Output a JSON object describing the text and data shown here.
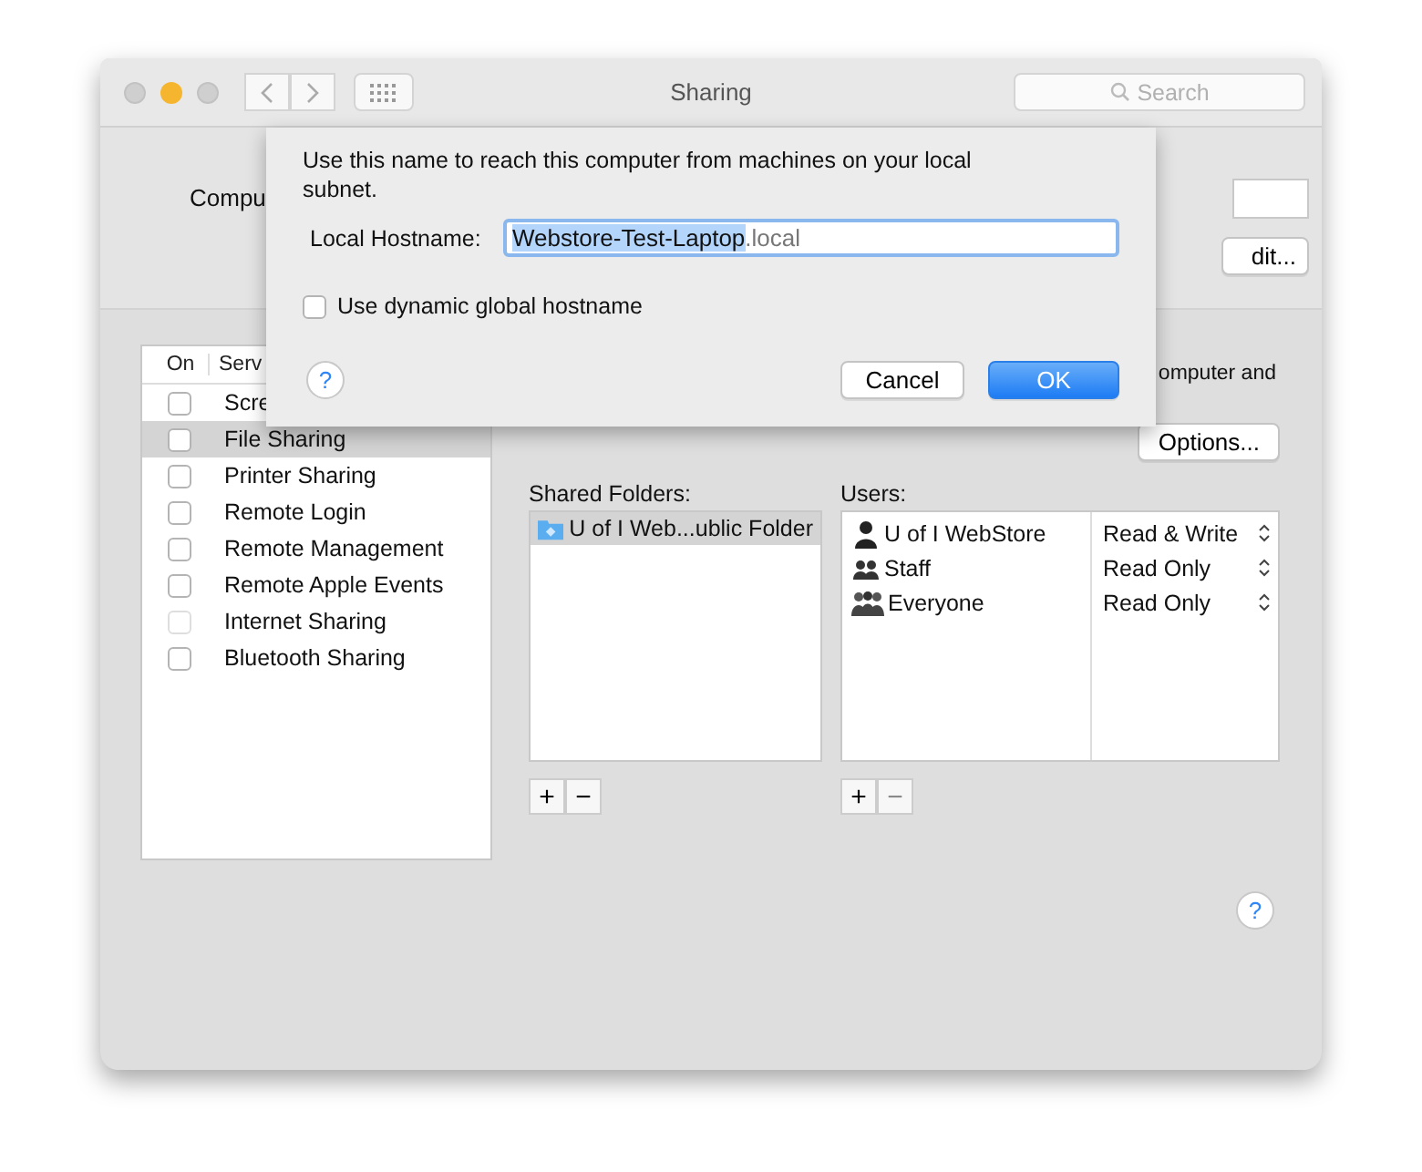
{
  "window": {
    "title": "Sharing",
    "search": {
      "placeholder": "Search"
    }
  },
  "computer_name": {
    "label": "Compu",
    "edit_button": "dit..."
  },
  "services": {
    "columns": [
      "On",
      "Serv"
    ],
    "items": [
      {
        "name": "Scre",
        "checked": false,
        "disabled": false,
        "selected": false
      },
      {
        "name": "File Sharing",
        "checked": false,
        "disabled": false,
        "selected": true
      },
      {
        "name": "Printer Sharing",
        "checked": false,
        "disabled": false,
        "selected": false
      },
      {
        "name": "Remote Login",
        "checked": false,
        "disabled": false,
        "selected": false
      },
      {
        "name": "Remote Management",
        "checked": false,
        "disabled": false,
        "selected": false
      },
      {
        "name": "Remote Apple Events",
        "checked": false,
        "disabled": false,
        "selected": false
      },
      {
        "name": "Internet Sharing",
        "checked": false,
        "disabled": true,
        "selected": false
      },
      {
        "name": "Bluetooth Sharing",
        "checked": false,
        "disabled": false,
        "selected": false
      }
    ]
  },
  "status_text": "omputer and",
  "options_button": "Options...",
  "shared_folders": {
    "label": "Shared Folders:",
    "items": [
      {
        "name": "U of I Web...ublic Folder",
        "selected": true
      }
    ],
    "add": "+",
    "remove": "−",
    "remove_disabled": false
  },
  "users": {
    "label": "Users:",
    "items": [
      {
        "kind": "user",
        "name": "U of I WebStore",
        "permission": "Read & Write"
      },
      {
        "kind": "group",
        "name": "Staff",
        "permission": "Read Only"
      },
      {
        "kind": "everyone",
        "name": "Everyone",
        "permission": "Read Only"
      }
    ],
    "add": "+",
    "remove": "−",
    "remove_disabled": true
  },
  "help_button": "?",
  "sheet": {
    "message": "Use this name to reach this computer from machines on your local subnet.",
    "hostname_label": "Local Hostname:",
    "hostname_selected": "Webstore-Test-Laptop",
    "hostname_suffix": ".local",
    "dynamic_checkbox": {
      "label": "Use dynamic global hostname",
      "checked": false
    },
    "help": "?",
    "cancel": "Cancel",
    "ok": "OK"
  }
}
